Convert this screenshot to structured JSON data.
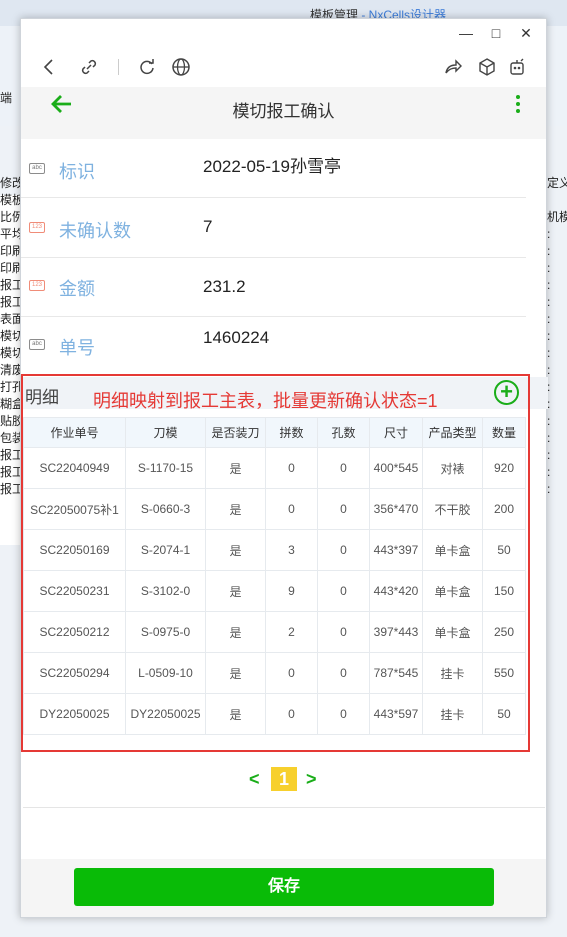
{
  "host": {
    "window_title": "模板管理",
    "window_title_suffix": " - NxCells设计器",
    "left_column": [
      "端",
      "",
      "",
      "",
      "",
      "修改",
      "模板",
      "比例",
      "平均",
      "印刷",
      "印刷",
      "报工",
      "报工",
      "表面",
      "模切",
      "模切",
      "清废",
      "打孔",
      "糊盒",
      "贴胶",
      "包装",
      "报工",
      "报工",
      "报工"
    ],
    "right_column": [
      "定义",
      "",
      "机模",
      ":",
      ":",
      ":",
      ":",
      ":",
      ":",
      ":",
      ":",
      ":",
      ":",
      ":",
      ":",
      ":",
      ":",
      ":",
      ":"
    ]
  },
  "browser": {
    "back_icon": "chevron-left-icon",
    "link_icon": "link-icon",
    "refresh_icon": "refresh-icon",
    "globe_icon": "globe-icon",
    "share_icon": "share-icon",
    "cube_icon": "cube-icon",
    "bot_icon": "bot-icon"
  },
  "header": {
    "title": "模切报工确认"
  },
  "fields": [
    {
      "label": "标识",
      "value": "2022-05-19孙雪亭",
      "icon": "abc"
    },
    {
      "label": "未确认数",
      "value": "7",
      "icon": "123"
    },
    {
      "label": "金额",
      "value": "231.2",
      "icon": "123"
    },
    {
      "label": "单号",
      "value": "1460224",
      "icon": "abc"
    }
  ],
  "detail": {
    "label": "明细",
    "annotation": "明细映射到报工主表，批量更新确认状态=1",
    "columns": [
      "作业单号",
      "刀模",
      "是否装刀",
      "拼数",
      "孔数",
      "尺寸",
      "产品类型",
      "数量"
    ],
    "rows": [
      [
        "SC22040949",
        "S-1170-15",
        "是",
        "0",
        "0",
        "400*545",
        "对裱",
        "920"
      ],
      [
        "SC22050075补1",
        "S-0660-3",
        "是",
        "0",
        "0",
        "356*470",
        "不干胶",
        "200"
      ],
      [
        "SC22050169",
        "S-2074-1",
        "是",
        "3",
        "0",
        "443*397",
        "单卡盒",
        "50"
      ],
      [
        "SC22050231",
        "S-3102-0",
        "是",
        "9",
        "0",
        "443*420",
        "单卡盒",
        "150"
      ],
      [
        "SC22050212",
        "S-0975-0",
        "是",
        "2",
        "0",
        "397*443",
        "单卡盒",
        "250"
      ],
      [
        "SC22050294",
        "L-0509-10",
        "是",
        "0",
        "0",
        "787*545",
        "挂卡",
        "550"
      ],
      [
        "DY22050025",
        "DY22050025",
        "是",
        "0",
        "0",
        "443*597",
        "挂卡",
        "50"
      ]
    ]
  },
  "pager": {
    "prev": "<",
    "current": "1",
    "next": ">"
  },
  "footer": {
    "save_label": "保存"
  },
  "colors": {
    "accent": "#1aad19",
    "annotation": "#e53935",
    "page_highlight": "#f7d02d"
  }
}
